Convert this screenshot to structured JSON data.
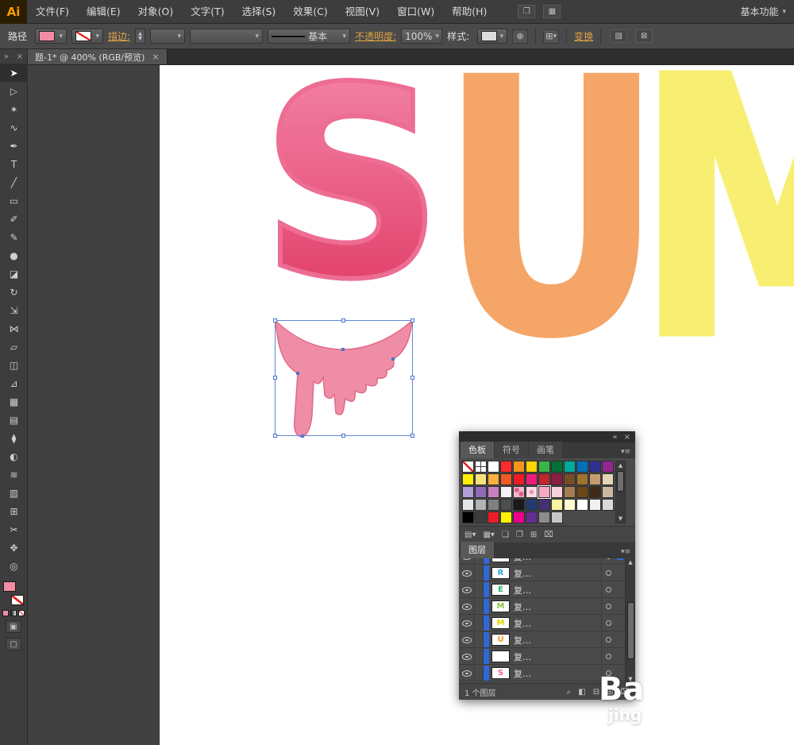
{
  "menubar": {
    "logo": "Ai",
    "items": [
      "文件(F)",
      "编辑(E)",
      "对象(O)",
      "文字(T)",
      "选择(S)",
      "效果(C)",
      "视图(V)",
      "窗口(W)",
      "帮助(H)"
    ],
    "icons": [
      {
        "name": "bridge-icon",
        "glyph": "❒"
      },
      {
        "name": "arrange-documents-icon",
        "glyph": "▦"
      }
    ],
    "workspace": "基本功能",
    "workspace_caret": "▾"
  },
  "controlbar": {
    "context_label": "路径",
    "fill_color": "#f28ca4",
    "stroke_label": "描边:",
    "stroke_width_value": "",
    "brush_value": "",
    "line_style_value": "基本",
    "opacity_label": "不透明度:",
    "opacity_value": "100%",
    "style_label": "样式:",
    "recolor_glyph": "⊕",
    "align_glyph": "⊞",
    "transform_label": "变换",
    "extra_icons": [
      {
        "name": "shape-mode-icon",
        "glyph": "▧"
      },
      {
        "name": "isolation-mode-icon",
        "glyph": "⊠"
      }
    ]
  },
  "docbar": {
    "tab_title": "题-1* @ 400% (RGB/预览)",
    "close_glyph": "×"
  },
  "toolbar": {
    "collapse_glyph": "»",
    "close_glyph": "×",
    "fill_color": "#f28ca4",
    "active_tool": "selection-tool",
    "tools": [
      {
        "name": "selection-tool",
        "glyph": "➤"
      },
      {
        "name": "direct-selection-tool",
        "glyph": "▷"
      },
      {
        "name": "magic-wand-tool",
        "glyph": "✶"
      },
      {
        "name": "lasso-tool",
        "glyph": "∿"
      },
      {
        "name": "pen-tool",
        "glyph": "✒"
      },
      {
        "name": "type-tool",
        "glyph": "T"
      },
      {
        "name": "line-segment-tool",
        "glyph": "╱"
      },
      {
        "name": "rectangle-tool",
        "glyph": "▭"
      },
      {
        "name": "paintbrush-tool",
        "glyph": "✐"
      },
      {
        "name": "pencil-tool",
        "glyph": "✎"
      },
      {
        "name": "blob-brush-tool",
        "glyph": "●"
      },
      {
        "name": "eraser-tool",
        "glyph": "◪"
      },
      {
        "name": "rotate-tool",
        "glyph": "↻"
      },
      {
        "name": "scale-tool",
        "glyph": "⇲"
      },
      {
        "name": "width-tool",
        "glyph": "⋈"
      },
      {
        "name": "free-transform-tool",
        "glyph": "▱"
      },
      {
        "name": "shape-builder-tool",
        "glyph": "◫"
      },
      {
        "name": "perspective-grid-tool",
        "glyph": "⊿"
      },
      {
        "name": "mesh-tool",
        "glyph": "▦"
      },
      {
        "name": "gradient-tool",
        "glyph": "▤"
      },
      {
        "name": "eyedropper-tool",
        "glyph": "⧫"
      },
      {
        "name": "blend-tool",
        "glyph": "◐"
      },
      {
        "name": "symbol-sprayer-tool",
        "glyph": "≋"
      },
      {
        "name": "column-graph-tool",
        "glyph": "▥"
      },
      {
        "name": "artboard-tool",
        "glyph": "⊞"
      },
      {
        "name": "slice-tool",
        "glyph": "✂"
      },
      {
        "name": "hand-tool",
        "glyph": "✥"
      },
      {
        "name": "zoom-tool",
        "glyph": "◎"
      }
    ]
  },
  "canvas": {
    "letters": [
      {
        "char": "S",
        "color": "#ea5a82",
        "gradient_top": "#f27ea3",
        "gradient_bottom": "#e03a64",
        "stroke": "#ed6d93"
      },
      {
        "char": "U",
        "color": "#f5a567"
      },
      {
        "char": "M",
        "color": "#f8ef72"
      }
    ],
    "selection_shape": {
      "fill": "#f08da6",
      "stroke": "#e06a88",
      "anchor_color": "#4a74cf"
    }
  },
  "panels": {
    "swatches": {
      "strip_collapse": "«",
      "strip_close": "×",
      "tabs": [
        "色板",
        "符号",
        "画笔"
      ],
      "active_tab": 0,
      "menu_glyph": "▾≡",
      "selected": [
        2,
        6
      ],
      "grid": [
        [
          "none",
          "reg",
          "#ffffff",
          "#ff2a2a",
          "#f7931e",
          "#ffd400",
          "#39b54a",
          "#007236",
          "#00a99d",
          "#0071bc",
          "#2e3192",
          "#92278f"
        ],
        [
          "#fff200",
          "#f9e27d",
          "#fbb03b",
          "#f15a24",
          "#ed1c24",
          "#ed1e79",
          "#c1272d",
          "#8c1d40",
          "#754c24",
          "#a0722d",
          "#c69c6e",
          "#e6d2b5"
        ],
        [
          "#b39ddb",
          "#8e6bb8",
          "#c97fc4",
          "#f2f2f2",
          "pat1",
          "pat2",
          "#f7a8c3",
          "#fbd0dd",
          "#a67c52",
          "#6d4617",
          "#3f2a14",
          "#cbb8a0"
        ],
        [
          "#e6e6e6",
          "#b3b3b3",
          "#808080",
          "#4d4d4d",
          "#1a1a1a",
          "#223a70",
          "#463073",
          "#f7f3a0",
          "#fffbd0",
          "#ffffff",
          "#f0f0f0",
          "#d9d9d9"
        ],
        [
          "#000000",
          "#3d3d3d",
          "#ed1c24",
          "#fff200",
          "#ec008c",
          "#662d91",
          "#8c8c8c",
          "#c8c8c8",
          "",
          "",
          "",
          ""
        ]
      ],
      "footer_icons": [
        {
          "name": "swatch-libraries-icon",
          "glyph": "▤▾"
        },
        {
          "name": "show-swatch-kinds-icon",
          "glyph": "▦▾"
        },
        {
          "name": "swatch-options-icon",
          "glyph": "❏"
        },
        {
          "name": "new-color-group-icon",
          "glyph": "❐"
        },
        {
          "name": "new-swatch-icon",
          "glyph": "⊞"
        },
        {
          "name": "delete-swatch-icon",
          "glyph": "⌧"
        }
      ]
    },
    "layers": {
      "tab_label": "图层",
      "menu_glyph": "▾≡",
      "rows": [
        {
          "letter": "",
          "letter_color": "#888888",
          "label": "复…",
          "partial": true,
          "selected": true
        },
        {
          "letter": "R",
          "letter_color": "#29a8e0",
          "label": "复…"
        },
        {
          "letter": "E",
          "letter_color": "#2bb673",
          "label": "复…"
        },
        {
          "letter": "M",
          "letter_color": "#8dc63f",
          "label": "复…"
        },
        {
          "letter": "M",
          "letter_color": "#e8d400",
          "label": "复…"
        },
        {
          "letter": "U",
          "letter_color": "#f7941e",
          "label": "复…"
        },
        {
          "letter": "",
          "letter_color": "#cccccc",
          "label": "复…"
        },
        {
          "letter": "S",
          "letter_color": "#f06292",
          "label": "复…"
        }
      ],
      "footer": {
        "count_text": "1 个图层",
        "icons": [
          {
            "name": "locate-object-icon",
            "glyph": "⌕"
          },
          {
            "name": "make-clipping-mask-icon",
            "glyph": "◧"
          },
          {
            "name": "new-sublayer-icon",
            "glyph": "⊟"
          },
          {
            "name": "new-layer-icon",
            "glyph": "⊞"
          },
          {
            "name": "delete-selection-icon",
            "glyph": "⌧"
          }
        ]
      }
    }
  },
  "watermark": {
    "line1": "Ba",
    "line2": "jing"
  }
}
